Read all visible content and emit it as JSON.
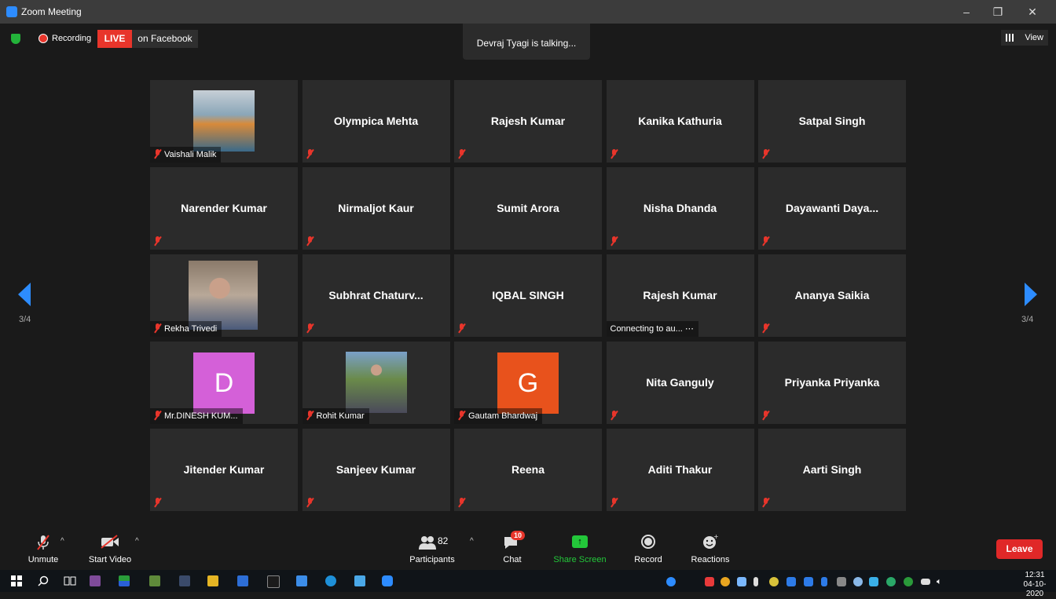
{
  "window": {
    "title": "Zoom Meeting",
    "minimize": "–",
    "restore": "❐",
    "close": "✕"
  },
  "topbar": {
    "recording": "Recording",
    "live": "LIVE",
    "on_facebook": "on Facebook",
    "talking": "Devraj Tyagi is talking...",
    "view": "View"
  },
  "pager": {
    "left": "3/4",
    "right": "3/4"
  },
  "tiles": [
    {
      "name": "Vaishali Malik",
      "type": "photo",
      "muted": true
    },
    {
      "name": "Olympica Mehta",
      "type": "name",
      "muted": true
    },
    {
      "name": "Rajesh Kumar",
      "type": "name",
      "muted": true
    },
    {
      "name": "Kanika Kathuria",
      "type": "name",
      "muted": true
    },
    {
      "name": "Satpal Singh",
      "type": "name",
      "muted": true
    },
    {
      "name": "Narender Kumar",
      "type": "name",
      "muted": true
    },
    {
      "name": "Nirmaljot Kaur",
      "type": "name",
      "muted": true
    },
    {
      "name": "Sumit Arora",
      "type": "name",
      "muted": false
    },
    {
      "name": "Nisha Dhanda",
      "type": "name",
      "muted": true
    },
    {
      "name": "Dayawanti  Daya...",
      "type": "name",
      "muted": true
    },
    {
      "name": "Rekha Trivedi",
      "type": "photo",
      "muted": true
    },
    {
      "name": "Subhrat  Chaturv...",
      "type": "name",
      "muted": true
    },
    {
      "name": "IQBAL SINGH",
      "type": "name",
      "muted": true
    },
    {
      "name": "Rajesh Kumar",
      "type": "name",
      "muted": false,
      "status": "Connecting to au... ⋯"
    },
    {
      "name": "Ananya Saikia",
      "type": "name",
      "muted": true
    },
    {
      "name": "Mr.DINESH KUM...",
      "type": "avatar",
      "letter": "D",
      "color": "#d460d8",
      "muted": true
    },
    {
      "name": "Rohit Kumar",
      "type": "photo",
      "muted": true
    },
    {
      "name": "Gautam Bhardwaj",
      "type": "avatar",
      "letter": "G",
      "color": "#e8521c",
      "muted": true
    },
    {
      "name": "Nita Ganguly",
      "type": "name",
      "muted": true
    },
    {
      "name": "Priyanka Priyanka",
      "type": "name",
      "muted": true
    },
    {
      "name": "Jitender Kumar",
      "type": "name",
      "muted": true
    },
    {
      "name": "Sanjeev Kumar",
      "type": "name",
      "muted": true
    },
    {
      "name": "Reena",
      "type": "name",
      "muted": true
    },
    {
      "name": "Aditi Thakur",
      "type": "name",
      "muted": true
    },
    {
      "name": "Aarti Singh",
      "type": "name",
      "muted": true
    }
  ],
  "toolbar": {
    "unmute": "Unmute",
    "start_video": "Start Video",
    "participants": "Participants",
    "participants_count": "82",
    "chat": "Chat",
    "chat_badge": "10",
    "share_screen": "Share Screen",
    "record": "Record",
    "reactions": "Reactions",
    "leave": "Leave",
    "caret": "^"
  },
  "taskbar": {
    "time": "12:31",
    "date": "04-10-2020"
  },
  "colors": {
    "accent": "#2d8cff",
    "live": "#e8352b",
    "share": "#23c73a",
    "leave": "#e02828"
  }
}
